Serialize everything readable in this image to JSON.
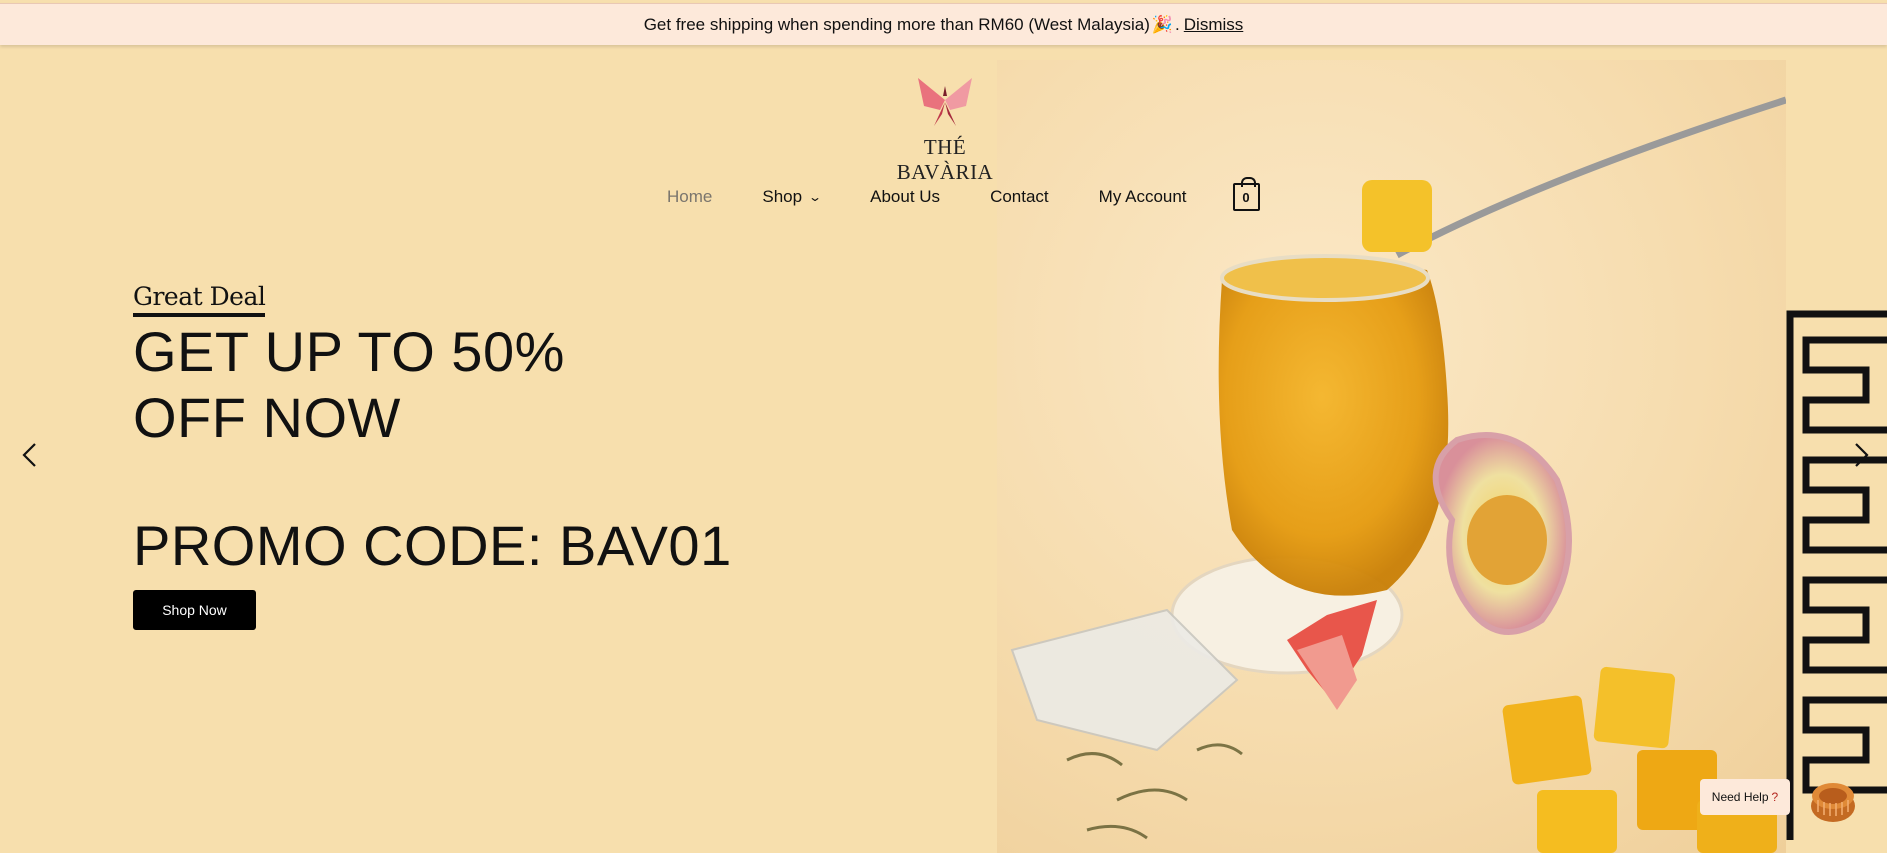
{
  "announcement": {
    "text": "Get free shipping when spending more than RM60 (West Malaysia) ",
    "emoji": "🎉",
    "suffix": ".",
    "dismiss_label": "Dismiss"
  },
  "logo": {
    "text": "THÉ BAVÀRIA"
  },
  "nav": {
    "items": [
      {
        "label": "Home"
      },
      {
        "label": "Shop"
      },
      {
        "label": "About Us"
      },
      {
        "label": "Contact"
      },
      {
        "label": "My Account"
      }
    ],
    "cart_count": "0"
  },
  "hero": {
    "eyebrow": "Great Deal",
    "headline_line1": "GET UP TO 50%",
    "headline_line2": "OFF NOW",
    "promo": "PROMO CODE: BAV01",
    "cta_label": "Shop Now"
  },
  "help": {
    "label": "Need Help",
    "mark": "?"
  },
  "colors": {
    "background": "#f7dfad",
    "announcement_bg": "#fde9da",
    "button_bg": "#000000",
    "logo_pink": "#e9727d"
  },
  "icons": [
    "butterfly-logo-icon",
    "chevron-down-icon",
    "cart-icon",
    "chevron-left-icon",
    "chevron-right-icon",
    "mooncake-icon"
  ]
}
